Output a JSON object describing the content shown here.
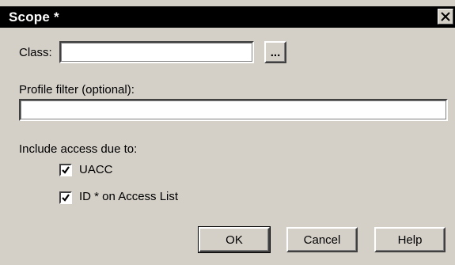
{
  "dialog": {
    "title": "Scope *",
    "close_icon": "close-icon"
  },
  "class_field": {
    "label": "Class:",
    "value": "",
    "browse_label": "..."
  },
  "profile_filter": {
    "label": "Profile filter (optional):",
    "value": ""
  },
  "include_access": {
    "label": "Include access due to:",
    "options": [
      {
        "label": "UACC",
        "checked": true
      },
      {
        "label": "ID * on Access List",
        "checked": true
      }
    ]
  },
  "buttons": {
    "ok": "OK",
    "cancel": "Cancel",
    "help": "Help"
  }
}
